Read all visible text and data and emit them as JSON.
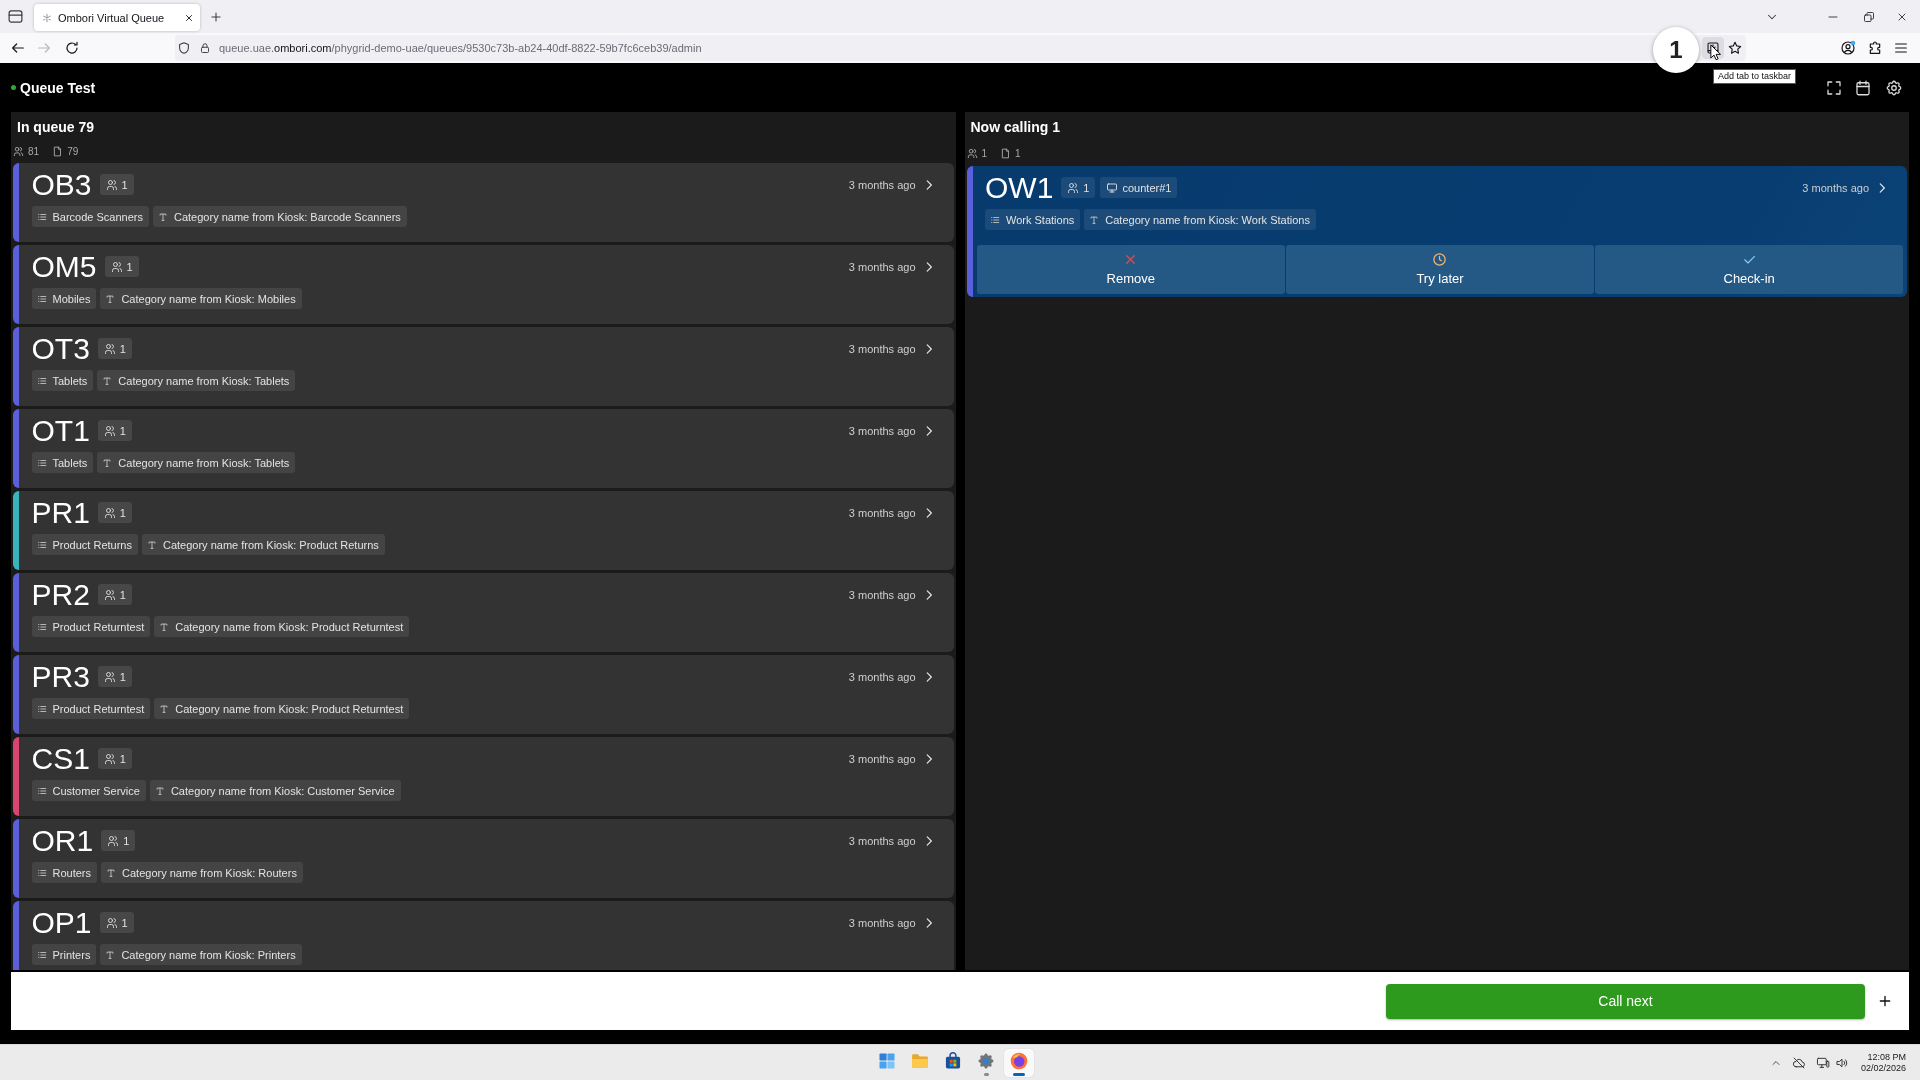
{
  "browser": {
    "tabs": [
      {
        "title": "Ombori Virtual Queue",
        "selected": true
      }
    ],
    "back_enabled": true,
    "forward_enabled": false,
    "url": "queue.uae.**ombori.com**/phygrid-demo-uae/queues/9530c73b-ab24-40df-8822-59b7fc6ceb39/admin",
    "install_hovered": true,
    "account_notification": true,
    "tooltip": "Add tab to taskbar"
  },
  "annotation": {
    "step": "1"
  },
  "app": {
    "title": "Queue Test",
    "connected": true
  },
  "panels": [
    {
      "kind": "queue",
      "title": "In queue 79",
      "people_count": "81",
      "ticket_count": "79",
      "tickets": [
        {
          "code": "OB3",
          "party": "1",
          "time": "3 months ago",
          "color": "#5b5fd9",
          "tags": [
            {
              "kind": "category",
              "text": "Barcode Scanners"
            },
            {
              "kind": "field",
              "text": "Category name from Kiosk: Barcode Scanners"
            }
          ]
        },
        {
          "code": "OM5",
          "party": "1",
          "time": "3 months ago",
          "color": "#5b5fd9",
          "tags": [
            {
              "kind": "category",
              "text": "Mobiles"
            },
            {
              "kind": "field",
              "text": "Category name from Kiosk: Mobiles"
            }
          ]
        },
        {
          "code": "OT3",
          "party": "1",
          "time": "3 months ago",
          "color": "#5b5fd9",
          "tags": [
            {
              "kind": "category",
              "text": "Tablets"
            },
            {
              "kind": "field",
              "text": "Category name from Kiosk: Tablets"
            }
          ]
        },
        {
          "code": "OT1",
          "party": "1",
          "time": "3 months ago",
          "color": "#5b5fd9",
          "tags": [
            {
              "kind": "category",
              "text": "Tablets"
            },
            {
              "kind": "field",
              "text": "Category name from Kiosk: Tablets"
            }
          ]
        },
        {
          "code": "PR1",
          "party": "1",
          "time": "3 months ago",
          "color": "#3bb3bd",
          "tags": [
            {
              "kind": "category",
              "text": "Product Returns"
            },
            {
              "kind": "field",
              "text": "Category name from Kiosk: Product Returns"
            }
          ]
        },
        {
          "code": "PR2",
          "party": "1",
          "time": "3 months ago",
          "color": "#5b5fd9",
          "tags": [
            {
              "kind": "category",
              "text": "Product Returntest"
            },
            {
              "kind": "field",
              "text": "Category name from Kiosk: Product Returntest"
            }
          ]
        },
        {
          "code": "PR3",
          "party": "1",
          "time": "3 months ago",
          "color": "#5b5fd9",
          "tags": [
            {
              "kind": "category",
              "text": "Product Returntest"
            },
            {
              "kind": "field",
              "text": "Category name from Kiosk: Product Returntest"
            }
          ]
        },
        {
          "code": "CS1",
          "party": "1",
          "time": "3 months ago",
          "color": "#d8456f",
          "tags": [
            {
              "kind": "category",
              "text": "Customer Service"
            },
            {
              "kind": "field",
              "text": "Category name from Kiosk: Customer Service"
            }
          ]
        },
        {
          "code": "OR1",
          "party": "1",
          "time": "3 months ago",
          "color": "#5b5fd9",
          "tags": [
            {
              "kind": "category",
              "text": "Routers"
            },
            {
              "kind": "field",
              "text": "Category name from Kiosk: Routers"
            }
          ]
        },
        {
          "code": "OP1",
          "party": "1",
          "time": "3 months ago",
          "color": "#5b5fd9",
          "tags": [
            {
              "kind": "category",
              "text": "Printers"
            },
            {
              "kind": "field",
              "text": "Category name from Kiosk: Printers"
            }
          ]
        }
      ]
    },
    {
      "kind": "calling",
      "title": "Now calling 1",
      "people_count": "1",
      "ticket_count": "1",
      "tickets": [
        {
          "code": "OW1",
          "party": "1",
          "counter": "counter#1",
          "time": "3 months ago",
          "color": "#5b5fd9",
          "tags": [
            {
              "kind": "category",
              "text": "Work Stations"
            },
            {
              "kind": "field",
              "text": "Category name from Kiosk: Work Stations"
            }
          ],
          "actions": [
            {
              "kind": "remove",
              "label": "Remove"
            },
            {
              "kind": "try_later",
              "label": "Try later"
            },
            {
              "kind": "check_in",
              "label": "Check-in"
            }
          ]
        }
      ]
    }
  ],
  "footer": {
    "primary_button": "Call next"
  },
  "taskbar": {
    "apps": [
      {
        "kind": "start",
        "running": false,
        "focused": false
      },
      {
        "kind": "files",
        "running": false,
        "focused": false
      },
      {
        "kind": "store",
        "running": false,
        "focused": false
      },
      {
        "kind": "settings",
        "running": true,
        "focused": false
      },
      {
        "kind": "browser",
        "running": true,
        "focused": true
      }
    ],
    "time": "12:08 PM",
    "date": "02/02/2026"
  }
}
